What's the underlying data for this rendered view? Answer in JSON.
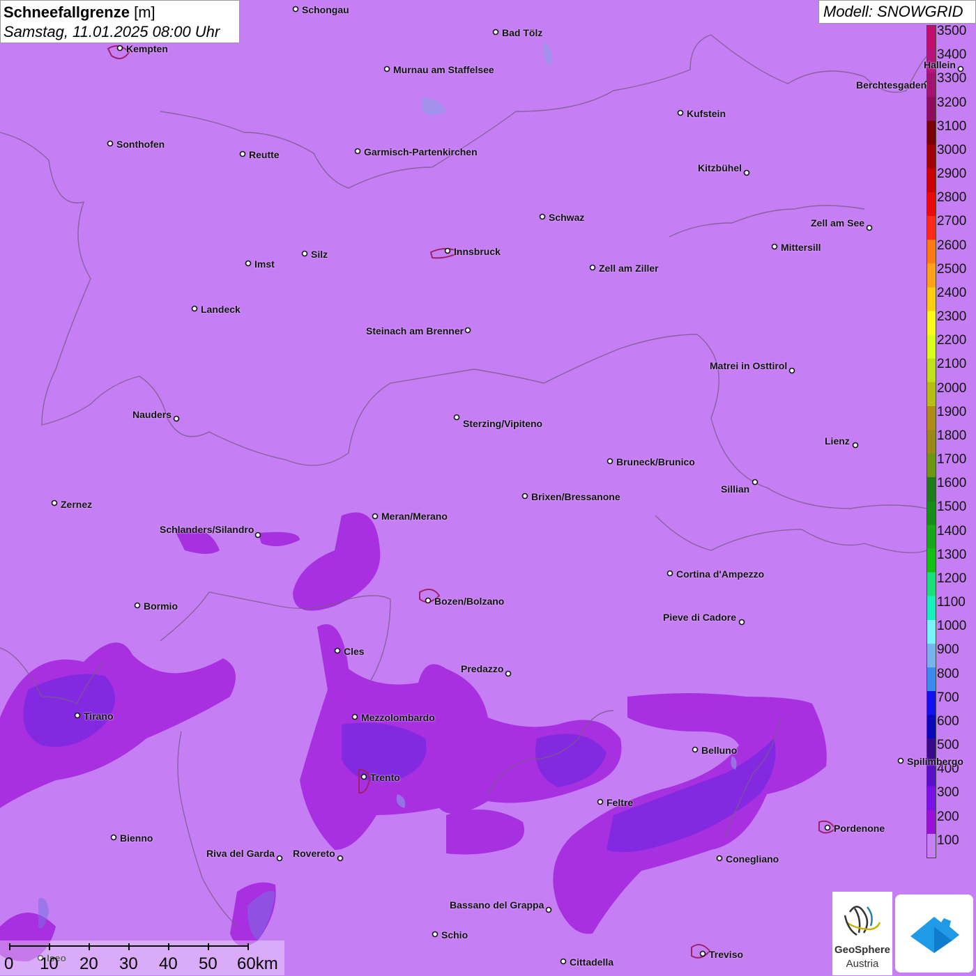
{
  "title": {
    "main": "Schneefallgrenze",
    "unit": "[m]",
    "date": "Samstag, 11.01.2025 08:00 Uhr"
  },
  "model": "Modell: SNOWGRID",
  "legend": {
    "labels": [
      "3500",
      "3400",
      "3300",
      "3200",
      "3100",
      "3000",
      "2900",
      "2800",
      "2700",
      "2600",
      "2500",
      "2400",
      "2300",
      "2200",
      "2100",
      "2000",
      "1900",
      "1800",
      "1700",
      "1600",
      "1500",
      "1400",
      "1300",
      "1200",
      "1100",
      "1000",
      "900",
      "800",
      "700",
      "600",
      "500",
      "400",
      "300",
      "200",
      "100"
    ],
    "colors": [
      "#c2106a",
      "#b7137a",
      "#a4126f",
      "#8d0c5c",
      "#7a0000",
      "#a30000",
      "#cc0000",
      "#ea0a0a",
      "#ff2a1a",
      "#ff7a10",
      "#ffa21a",
      "#ffcc10",
      "#ffff1a",
      "#d8ff1a",
      "#c2e017",
      "#b8bd14",
      "#b08a14",
      "#9a8a14",
      "#6c9610",
      "#1d7a1d",
      "#168f16",
      "#19a819",
      "#12c012",
      "#19e07a",
      "#19f0c0",
      "#7af5ff",
      "#78b4f0",
      "#3a8af0",
      "#1010f0",
      "#0808b8",
      "#3a0a8a",
      "#5a10c8",
      "#7a10e8",
      "#9a10d8",
      "#c87ef5"
    ]
  },
  "cities": [
    {
      "name": "Schongau"
    },
    {
      "name": "Kempten"
    },
    {
      "name": "Bad Tölz"
    },
    {
      "name": "Murnau am Staffelsee"
    },
    {
      "name": "Hallein"
    },
    {
      "name": "Berchtesgaden"
    },
    {
      "name": "Kufstein"
    },
    {
      "name": "Sonthofen"
    },
    {
      "name": "Reutte"
    },
    {
      "name": "Garmisch-Partenkirchen"
    },
    {
      "name": "Kitzbühel"
    },
    {
      "name": "Schwaz"
    },
    {
      "name": "Zell am See"
    },
    {
      "name": "Innsbruck"
    },
    {
      "name": "Mittersill"
    },
    {
      "name": "Imst"
    },
    {
      "name": "Silz"
    },
    {
      "name": "Zell am Ziller"
    },
    {
      "name": "Landeck"
    },
    {
      "name": "Steinach am Brenner"
    },
    {
      "name": "Matrei in Osttirol"
    },
    {
      "name": "Nauders"
    },
    {
      "name": "Sterzing/Vipiteno"
    },
    {
      "name": "Lienz"
    },
    {
      "name": "Bruneck/Brunico"
    },
    {
      "name": "Sillian"
    },
    {
      "name": "Zernez"
    },
    {
      "name": "Brixen/Bressanone"
    },
    {
      "name": "Meran/Merano"
    },
    {
      "name": "Schlanders/Silandro"
    },
    {
      "name": "Cortina d'Ampezzo"
    },
    {
      "name": "Bozen/Bolzano"
    },
    {
      "name": "Bormio"
    },
    {
      "name": "Pieve di Cadore"
    },
    {
      "name": "Cles"
    },
    {
      "name": "Predazzo"
    },
    {
      "name": "Tirano"
    },
    {
      "name": "Mezzolombardo"
    },
    {
      "name": "Belluno"
    },
    {
      "name": "Spilimbergo"
    },
    {
      "name": "Trento"
    },
    {
      "name": "Feltre"
    },
    {
      "name": "Pordenone"
    },
    {
      "name": "Bienno"
    },
    {
      "name": "Riva del Garda"
    },
    {
      "name": "Rovereto"
    },
    {
      "name": "Conegliano"
    },
    {
      "name": "Bassano del Grappa"
    },
    {
      "name": "Schio"
    },
    {
      "name": "Treviso"
    },
    {
      "name": "Cittadella"
    },
    {
      "name": "Iseo"
    }
  ],
  "scale": {
    "labels": [
      "0",
      "10",
      "20",
      "30",
      "40",
      "50",
      "60km"
    ]
  },
  "logo": {
    "line1": "GeoSphere",
    "line2": "Austria"
  }
}
